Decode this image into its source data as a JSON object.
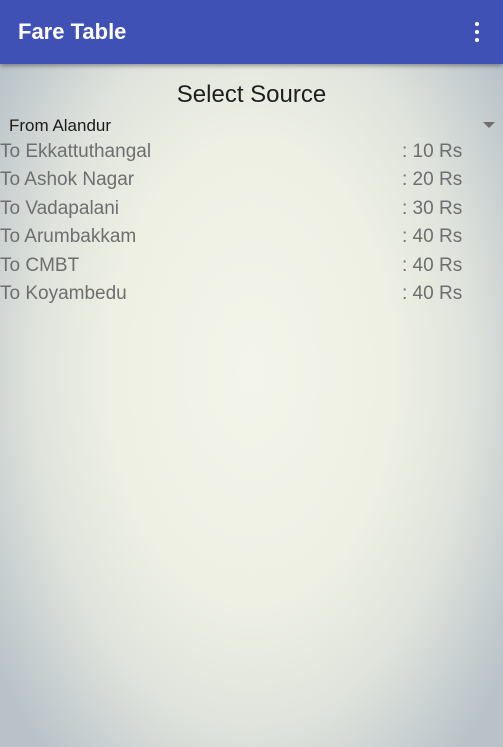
{
  "app_bar": {
    "title": "Fare Table",
    "background_color": "#3f51b5",
    "overflow_icon": "more-vert-icon"
  },
  "page": {
    "section_title": "Select Source",
    "source_select": {
      "selected": "From Alandur",
      "arrow_icon": "dropdown-arrow-icon"
    },
    "fares": [
      {
        "destination": "To Ekkattuthangal",
        "price": ": 10 Rs"
      },
      {
        "destination": "To Ashok Nagar",
        "price": ": 20 Rs"
      },
      {
        "destination": "To Vadapalani",
        "price": ": 30 Rs"
      },
      {
        "destination": "To Arumbakkam",
        "price": ": 40 Rs"
      },
      {
        "destination": "To CMBT",
        "price": ": 40 Rs"
      },
      {
        "destination": "To Koyambedu",
        "price": ": 40 Rs"
      }
    ]
  }
}
